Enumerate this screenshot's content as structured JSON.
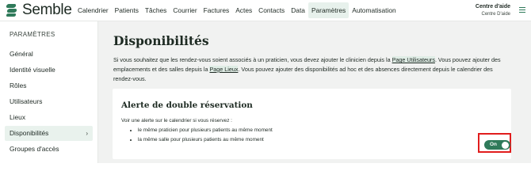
{
  "brand": {
    "name": "Semble",
    "color": "#2f7a5a"
  },
  "nav": {
    "items": [
      "Calendrier",
      "Patients",
      "Tâches",
      "Courrier",
      "Factures",
      "Actes",
      "Contacts",
      "Data",
      "Paramètres",
      "Automatisation"
    ],
    "active": "Paramètres"
  },
  "help": {
    "title": "Centre d'aide",
    "subtitle": "Centre D'aide"
  },
  "sidebar": {
    "title": "PARAMÈTRES",
    "items": [
      "Général",
      "Identité visuelle",
      "Rôles",
      "Utilisateurs",
      "Lieux",
      "Disponibilités",
      "Groupes d'accès"
    ],
    "active": "Disponibilités",
    "active_chevron": "›"
  },
  "main": {
    "title": "Disponibilités",
    "intro": {
      "p1": "Si vous souhaitez que les rendez-vous soient associés à un praticien, vous devez ajouter le clinicien depuis la ",
      "link1": "Page Utilisateurs",
      "p2": ". Vous pouvez ajouter des emplacements et des salles depuis la ",
      "link2": "Page Lieux",
      "p3": ". Vous pouvez ajouter des disponibilités ad hoc et des absences directement depuis le calendrier des rendez-vous."
    },
    "card": {
      "title": "Alerte de double réservation",
      "description": "Voir une alerte sur le calendrier si vous réservez :",
      "bullets": [
        "le même praticien pour plusieurs patients au même moment",
        "la même salle pour plusieurs patients au même moment"
      ],
      "toggle": {
        "label": "On",
        "state": true,
        "highlight_color": "#e11d1d"
      }
    }
  }
}
